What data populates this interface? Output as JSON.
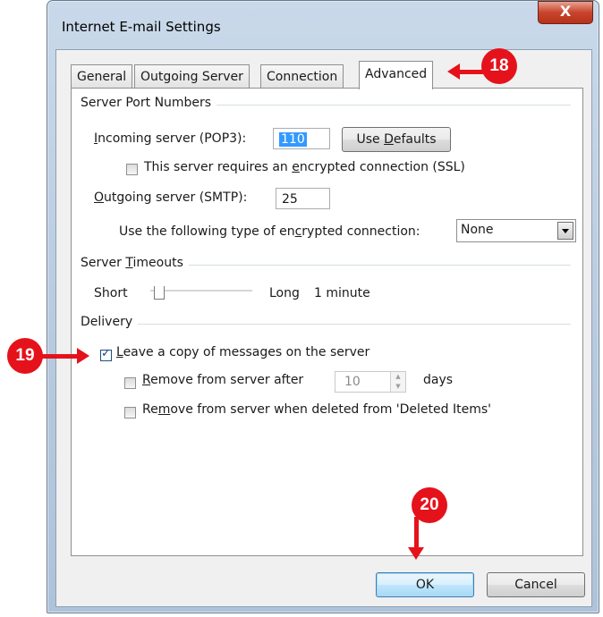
{
  "window": {
    "title": "Internet E-mail Settings",
    "close_glyph": "X"
  },
  "tabs": [
    {
      "label": "General"
    },
    {
      "label": "Outgoing Server"
    },
    {
      "label": "Connection"
    },
    {
      "label": "Advanced",
      "active": true
    }
  ],
  "server_ports": {
    "heading": "Server Port Numbers",
    "incoming_label_prefix": "",
    "incoming_label_underlined": "I",
    "incoming_label_rest": "ncoming server (POP3):",
    "incoming_value": "110",
    "use_defaults_prefix": "Use ",
    "use_defaults_underlined": "D",
    "use_defaults_rest": "efaults",
    "ssl_label_prefix": "This server requires an ",
    "ssl_label_underlined": "e",
    "ssl_label_rest": "ncrypted connection (SSL)",
    "ssl_checked": false,
    "outgoing_label_prefix": "",
    "outgoing_label_underlined": "O",
    "outgoing_label_rest": "utgoing server (SMTP):",
    "outgoing_value": "25",
    "encryption_label_prefix": "Use the following type of en",
    "encryption_label_underlined": "c",
    "encryption_label_rest": "rypted connection:",
    "encryption_value": "None"
  },
  "timeouts": {
    "heading_prefix": "Server ",
    "heading_underlined": "T",
    "heading_rest": "imeouts",
    "short_label": "Short",
    "long_label": "Long",
    "timeout_value": "1 minute"
  },
  "delivery": {
    "heading": "Delivery",
    "leave_copy_underlined": "L",
    "leave_copy_rest": "eave a copy of messages on the server",
    "leave_copy_checked": true,
    "remove_after_underlined": "R",
    "remove_after_rest": "emove from server after",
    "remove_after_checked": false,
    "remove_after_days": "10",
    "days_label": "days",
    "remove_deleted_prefix": "Re",
    "remove_deleted_underlined": "m",
    "remove_deleted_rest": "ove from server when deleted from 'Deleted Items'",
    "remove_deleted_checked": false
  },
  "footer": {
    "ok_label": "OK",
    "cancel_label": "Cancel"
  },
  "annotations": [
    {
      "number": "18",
      "target": "Advanced tab"
    },
    {
      "number": "19",
      "target": "Leave a copy checkbox"
    },
    {
      "number": "20",
      "target": "OK button"
    }
  ],
  "colors": {
    "annotation_red": "#e5121b",
    "selection_blue": "#3399ff"
  }
}
